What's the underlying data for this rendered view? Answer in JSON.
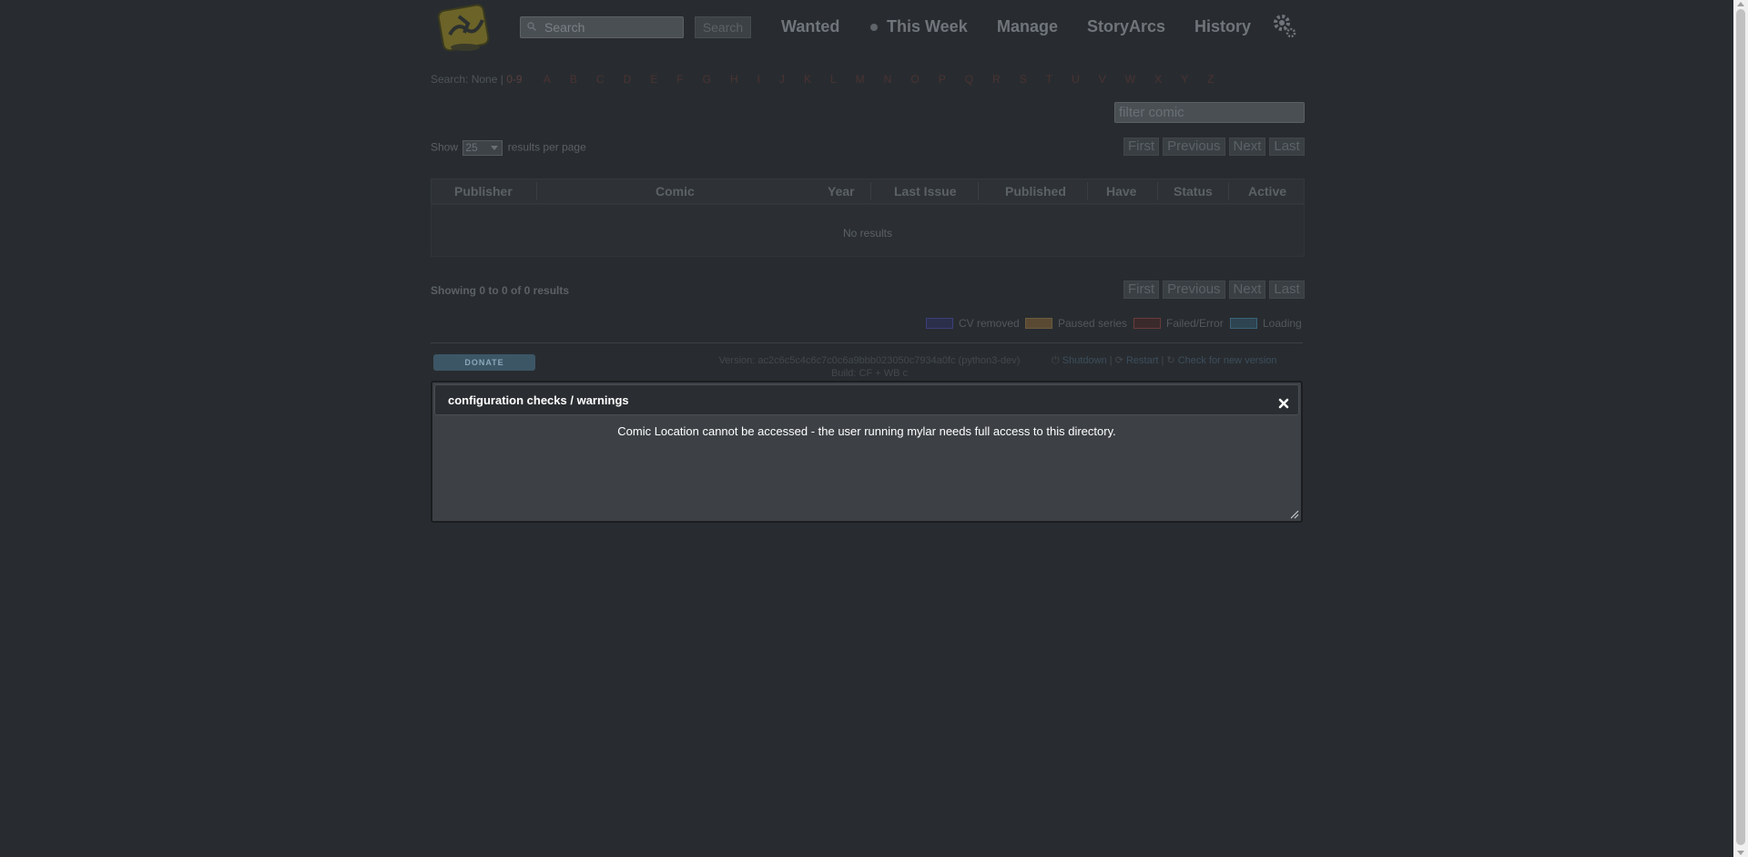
{
  "header": {
    "search_placeholder": "Search",
    "search_button": "Search",
    "nav": {
      "wanted": "Wanted",
      "this_week": "This Week",
      "manage": "Manage",
      "storyarcs": "StoryArcs",
      "history": "History"
    }
  },
  "alpha_nav": {
    "label": "Search: None",
    "separator": " | ",
    "first": "0-9",
    "letters": [
      "A",
      "B",
      "C",
      "D",
      "E",
      "F",
      "G",
      "H",
      "I",
      "J",
      "K",
      "L",
      "M",
      "N",
      "O",
      "P",
      "Q",
      "R",
      "S",
      "T",
      "U",
      "V",
      "W",
      "X",
      "Y",
      "Z"
    ]
  },
  "filter_placeholder": "filter comic",
  "paging": {
    "show_prefix": "Show",
    "per_page_value": "25",
    "show_suffix": "results per page",
    "first": "First",
    "previous": "Previous",
    "next": "Next",
    "last": "Last"
  },
  "table": {
    "columns": [
      "Publisher",
      "Comic",
      "Year",
      "Last Issue",
      "Published",
      "Have",
      "Status",
      "Active"
    ],
    "empty_message": "No results"
  },
  "showing": "Showing 0 to 0 of 0 results",
  "legend": [
    {
      "label": "CV removed",
      "border": "#3b3f7a",
      "fill": "#2c2f4a"
    },
    {
      "label": "Paused series",
      "border": "#6b5a3e",
      "fill": "#5a4a34"
    },
    {
      "label": "Failed/Error",
      "border": "#6b3a3a",
      "fill": "#3a2a2c"
    },
    {
      "label": "Loading",
      "border": "#3b6278",
      "fill": "#2e4450"
    }
  ],
  "footer": {
    "donate": "DONATE",
    "version_line1": "Version: ac2c6c5c4c6c7c0c6a9bbb023050c7934a0fc (python3-dev)",
    "version_line2": "Build: CF + WB c",
    "shutdown": "Shutdown",
    "restart": "Restart",
    "check_update": "Check for new version"
  },
  "dialog": {
    "title": "configuration checks / warnings",
    "message": "Comic Location cannot be accessed - the user running mylar needs full access to this directory."
  }
}
